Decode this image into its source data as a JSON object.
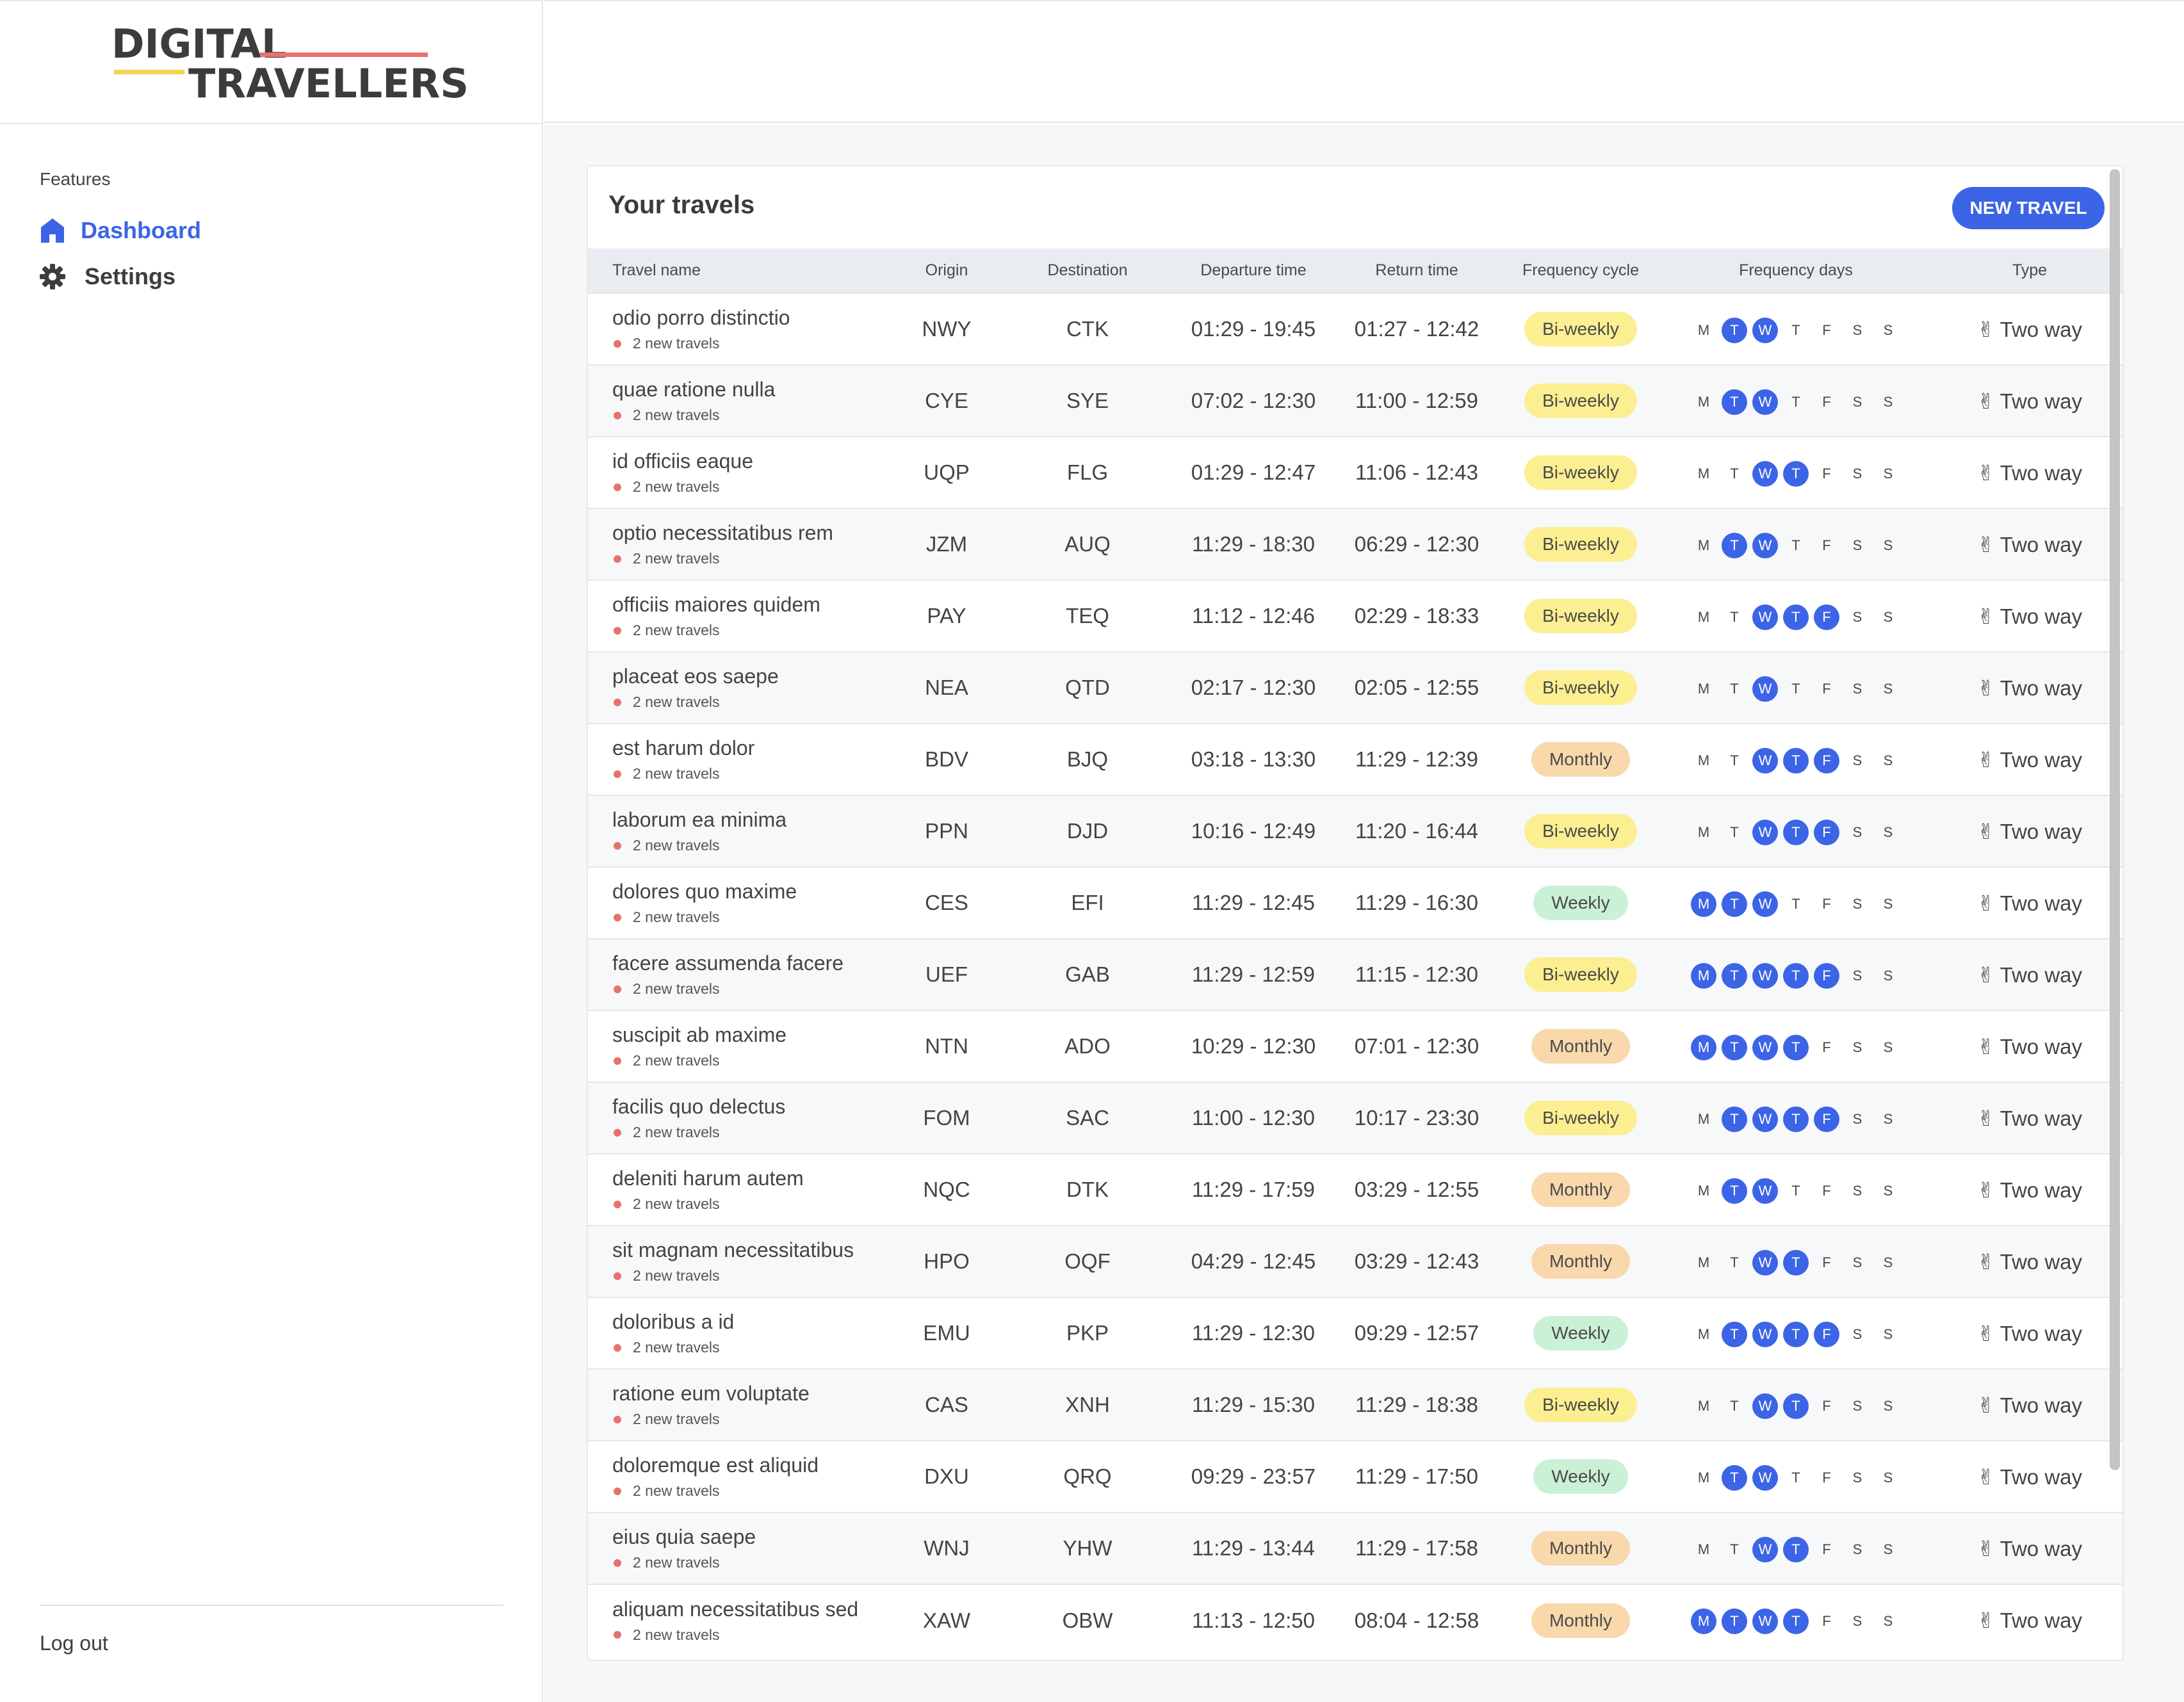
{
  "logo": {
    "line1": "DIGITAL",
    "line2": "TRAVELLERS",
    "accent_red": "#e8716e",
    "accent_yellow": "#f5d34a"
  },
  "sidebar": {
    "section_label": "Features",
    "items": [
      {
        "label": "Dashboard",
        "icon": "home-icon",
        "active": true
      },
      {
        "label": "Settings",
        "icon": "gear-icon",
        "active": false
      }
    ],
    "logout_label": "Log out"
  },
  "colors": {
    "primary": "#3c64e6",
    "biweekly": "#fbef91",
    "monthly": "#f9d8ac",
    "weekly": "#caf1d5"
  },
  "main": {
    "title": "Your travels",
    "new_travel_label": "NEW TRAVEL",
    "columns": [
      "Travel name",
      "Origin",
      "Destination",
      "Departure time",
      "Return time",
      "Frequency cycle",
      "Frequency days",
      "Type"
    ],
    "day_letters": [
      "M",
      "T",
      "W",
      "T",
      "F",
      "S",
      "S"
    ],
    "rows": [
      {
        "name": "odio porro distinctio",
        "sub": "2 new travels",
        "origin": "NWY",
        "destination": "CTK",
        "departure": "01:29 - 19:45",
        "return": "01:27 - 12:42",
        "cycle": "Bi-weekly",
        "days": [
          0,
          1,
          1,
          0,
          0,
          0,
          0
        ],
        "type": "Two way"
      },
      {
        "name": "quae ratione nulla",
        "sub": "2 new travels",
        "origin": "CYE",
        "destination": "SYE",
        "departure": "07:02 - 12:30",
        "return": "11:00 - 12:59",
        "cycle": "Bi-weekly",
        "days": [
          0,
          1,
          1,
          0,
          0,
          0,
          0
        ],
        "type": "Two way"
      },
      {
        "name": "id officiis eaque",
        "sub": "2 new travels",
        "origin": "UQP",
        "destination": "FLG",
        "departure": "01:29 - 12:47",
        "return": "11:06 - 12:43",
        "cycle": "Bi-weekly",
        "days": [
          0,
          0,
          1,
          1,
          0,
          0,
          0
        ],
        "type": "Two way"
      },
      {
        "name": "optio necessitatibus rem",
        "sub": "2 new travels",
        "origin": "JZM",
        "destination": "AUQ",
        "departure": "11:29 - 18:30",
        "return": "06:29 - 12:30",
        "cycle": "Bi-weekly",
        "days": [
          0,
          1,
          1,
          0,
          0,
          0,
          0
        ],
        "type": "Two way"
      },
      {
        "name": "officiis maiores quidem",
        "sub": "2 new travels",
        "origin": "PAY",
        "destination": "TEQ",
        "departure": "11:12 - 12:46",
        "return": "02:29 - 18:33",
        "cycle": "Bi-weekly",
        "days": [
          0,
          0,
          1,
          1,
          1,
          0,
          0
        ],
        "type": "Two way"
      },
      {
        "name": "placeat eos saepe",
        "sub": "2 new travels",
        "origin": "NEA",
        "destination": "QTD",
        "departure": "02:17 - 12:30",
        "return": "02:05 - 12:55",
        "cycle": "Bi-weekly",
        "days": [
          0,
          0,
          1,
          0,
          0,
          0,
          0
        ],
        "type": "Two way"
      },
      {
        "name": "est harum dolor",
        "sub": "2 new travels",
        "origin": "BDV",
        "destination": "BJQ",
        "departure": "03:18 - 13:30",
        "return": "11:29 - 12:39",
        "cycle": "Monthly",
        "days": [
          0,
          0,
          1,
          1,
          1,
          0,
          0
        ],
        "type": "Two way"
      },
      {
        "name": "laborum ea minima",
        "sub": "2 new travels",
        "origin": "PPN",
        "destination": "DJD",
        "departure": "10:16 - 12:49",
        "return": "11:20 - 16:44",
        "cycle": "Bi-weekly",
        "days": [
          0,
          0,
          1,
          1,
          1,
          0,
          0
        ],
        "type": "Two way"
      },
      {
        "name": "dolores quo maxime",
        "sub": "2 new travels",
        "origin": "CES",
        "destination": "EFI",
        "departure": "11:29 - 12:45",
        "return": "11:29 - 16:30",
        "cycle": "Weekly",
        "days": [
          1,
          1,
          1,
          0,
          0,
          0,
          0
        ],
        "type": "Two way"
      },
      {
        "name": "facere assumenda facere",
        "sub": "2 new travels",
        "origin": "UEF",
        "destination": "GAB",
        "departure": "11:29 - 12:59",
        "return": "11:15 - 12:30",
        "cycle": "Bi-weekly",
        "days": [
          1,
          1,
          1,
          1,
          1,
          0,
          0
        ],
        "type": "Two way"
      },
      {
        "name": "suscipit ab maxime",
        "sub": "2 new travels",
        "origin": "NTN",
        "destination": "ADO",
        "departure": "10:29 - 12:30",
        "return": "07:01 - 12:30",
        "cycle": "Monthly",
        "days": [
          1,
          1,
          1,
          1,
          0,
          0,
          0
        ],
        "type": "Two way"
      },
      {
        "name": "facilis quo delectus",
        "sub": "2 new travels",
        "origin": "FOM",
        "destination": "SAC",
        "departure": "11:00 - 12:30",
        "return": "10:17 - 23:30",
        "cycle": "Bi-weekly",
        "days": [
          0,
          1,
          1,
          1,
          1,
          0,
          0
        ],
        "type": "Two way"
      },
      {
        "name": "deleniti harum autem",
        "sub": "2 new travels",
        "origin": "NQC",
        "destination": "DTK",
        "departure": "11:29 - 17:59",
        "return": "03:29 - 12:55",
        "cycle": "Monthly",
        "days": [
          0,
          1,
          1,
          0,
          0,
          0,
          0
        ],
        "type": "Two way"
      },
      {
        "name": "sit magnam necessitatibus",
        "sub": "2 new travels",
        "origin": "HPO",
        "destination": "OQF",
        "departure": "04:29 - 12:45",
        "return": "03:29 - 12:43",
        "cycle": "Monthly",
        "days": [
          0,
          0,
          1,
          1,
          0,
          0,
          0
        ],
        "type": "Two way"
      },
      {
        "name": "doloribus a id",
        "sub": "2 new travels",
        "origin": "EMU",
        "destination": "PKP",
        "departure": "11:29 - 12:30",
        "return": "09:29 - 12:57",
        "cycle": "Weekly",
        "days": [
          0,
          1,
          1,
          1,
          1,
          0,
          0
        ],
        "type": "Two way"
      },
      {
        "name": "ratione eum voluptate",
        "sub": "2 new travels",
        "origin": "CAS",
        "destination": "XNH",
        "departure": "11:29 - 15:30",
        "return": "11:29 - 18:38",
        "cycle": "Bi-weekly",
        "days": [
          0,
          0,
          1,
          1,
          0,
          0,
          0
        ],
        "type": "Two way"
      },
      {
        "name": "doloremque est aliquid",
        "sub": "2 new travels",
        "origin": "DXU",
        "destination": "QRQ",
        "departure": "09:29 - 23:57",
        "return": "11:29 - 17:50",
        "cycle": "Weekly",
        "days": [
          0,
          1,
          1,
          0,
          0,
          0,
          0
        ],
        "type": "Two way"
      },
      {
        "name": "eius quia saepe",
        "sub": "2 new travels",
        "origin": "WNJ",
        "destination": "YHW",
        "departure": "11:29 - 13:44",
        "return": "11:29 - 17:58",
        "cycle": "Monthly",
        "days": [
          0,
          0,
          1,
          1,
          0,
          0,
          0
        ],
        "type": "Two way"
      },
      {
        "name": "aliquam necessitatibus sed",
        "sub": "2 new travels",
        "origin": "XAW",
        "destination": "OBW",
        "departure": "11:13 - 12:50",
        "return": "08:04 - 12:58",
        "cycle": "Monthly",
        "days": [
          1,
          1,
          1,
          1,
          0,
          0,
          0
        ],
        "type": "Two way"
      }
    ]
  }
}
